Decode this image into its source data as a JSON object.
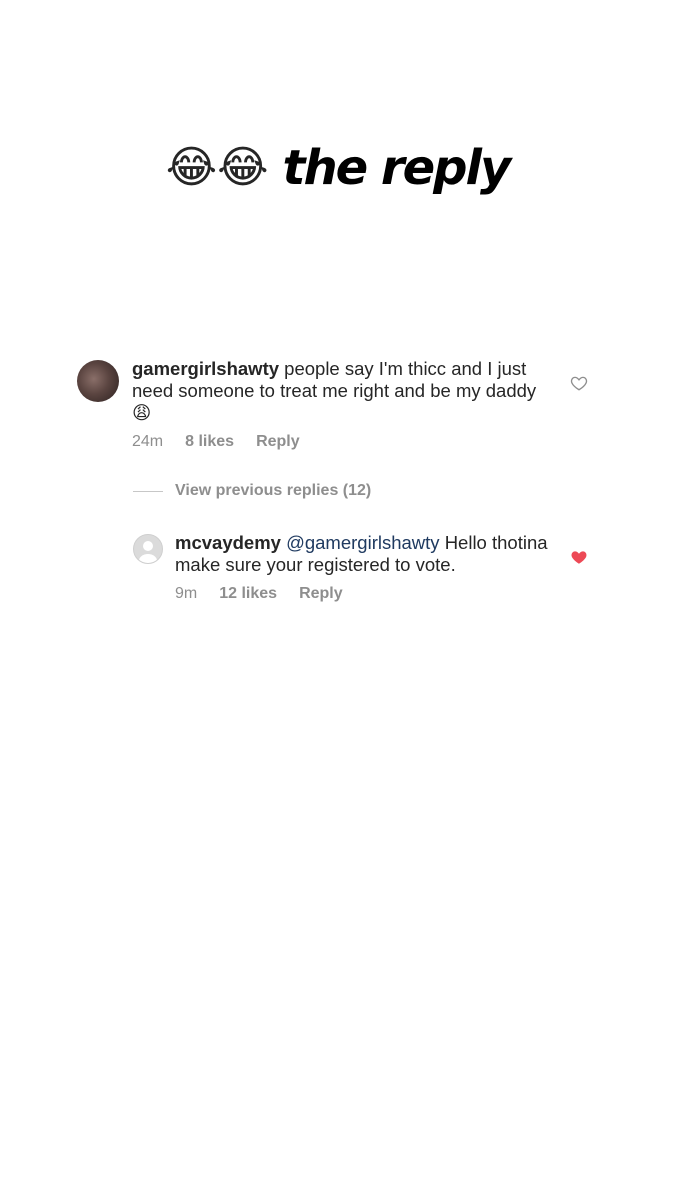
{
  "title": {
    "emoji": "😂😂",
    "text": "the reply"
  },
  "comment": {
    "username": "gamergirlshawty",
    "text": "people say I'm thicc and I just need someone to treat me right and be my daddy",
    "emoji": "😩",
    "time": "24m",
    "likes": "8 likes",
    "reply_label": "Reply",
    "like_icon": "heart-outline-icon"
  },
  "view_previous": "View previous replies (12)",
  "reply": {
    "username": "mcvaydemy",
    "mention": "@gamergirlshawty",
    "text": "Hello thotina make sure your registered to vote.",
    "time": "9m",
    "likes": "12 likes",
    "reply_label": "Reply",
    "like_icon": "heart-filled-icon",
    "like_color": "#ed4956"
  }
}
